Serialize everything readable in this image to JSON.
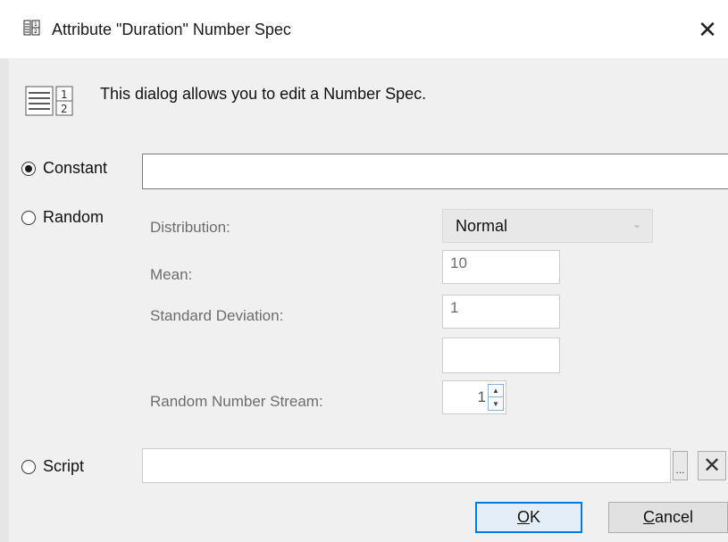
{
  "window": {
    "title": "Attribute \"Duration\" Number Spec",
    "close_glyph": "✕"
  },
  "description": "This dialog allows you to edit a Number Spec.",
  "options": {
    "constant": {
      "label": "Constant",
      "selected": true,
      "value": ""
    },
    "random": {
      "label": "Random",
      "selected": false
    },
    "script": {
      "label": "Script",
      "selected": false,
      "value": ""
    }
  },
  "random": {
    "distribution_label": "Distribution:",
    "distribution_value": "Normal",
    "mean_label": "Mean:",
    "mean_value": "10",
    "stddev_label": "Standard Deviation:",
    "stddev_value": "1",
    "extra_value": "",
    "stream_label": "Random Number Stream:",
    "stream_value": "1"
  },
  "script_controls": {
    "browse_label": "...",
    "clear_glyph": "✕"
  },
  "buttons": {
    "ok": {
      "mnemonic": "O",
      "rest": "K"
    },
    "cancel": {
      "mnemonic": "C",
      "rest": "ancel"
    }
  },
  "icons": {
    "title_icon": "number-spec-icon",
    "description_icon": "number-spec-large-icon"
  },
  "colors": {
    "accent": "#0078d7",
    "client_bg": "#f0f0f0",
    "disabled_text": "#6d6d6d"
  }
}
